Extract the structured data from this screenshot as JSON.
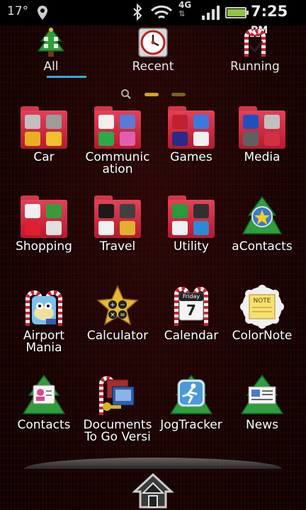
{
  "status_bar": {
    "temperature": "17°",
    "network": "4G",
    "time": "7:25",
    "ampm": "PM",
    "battery_level": 0.95
  },
  "tabs": [
    {
      "label": "All",
      "active": true,
      "icon": "all-apps-tree-icon"
    },
    {
      "label": "Recent",
      "active": false,
      "icon": "recent-clock-icon"
    },
    {
      "label": "Running",
      "active": false,
      "icon": "running-candy-cane-icon"
    }
  ],
  "pages": {
    "current": 1,
    "total": 2
  },
  "apps": [
    {
      "label": "Car",
      "type": "folder",
      "icon": "car-folder-icon"
    },
    {
      "label": "Communic\nation",
      "type": "folder",
      "icon": "communication-folder-icon"
    },
    {
      "label": "Games",
      "type": "folder",
      "icon": "games-folder-icon"
    },
    {
      "label": "Media",
      "type": "folder",
      "icon": "media-folder-icon"
    },
    {
      "label": "Shopping",
      "type": "folder",
      "icon": "shopping-folder-icon"
    },
    {
      "label": "Travel",
      "type": "folder",
      "icon": "travel-folder-icon"
    },
    {
      "label": "Utility",
      "type": "folder",
      "icon": "utility-folder-icon"
    },
    {
      "label": "aContacts",
      "type": "app",
      "icon": "acontacts-icon"
    },
    {
      "label": "Airport\nMania",
      "type": "app",
      "icon": "airport-mania-icon"
    },
    {
      "label": "Calculator",
      "type": "app",
      "icon": "calculator-icon"
    },
    {
      "label": "Calendar",
      "type": "app",
      "icon": "calendar-icon",
      "badge_day": "Friday",
      "badge_date": "7"
    },
    {
      "label": "ColorNote",
      "type": "app",
      "icon": "colornote-icon",
      "badge_text": "NOTE"
    },
    {
      "label": "Contacts",
      "type": "app",
      "icon": "contacts-icon"
    },
    {
      "label": "Documents\nTo Go Versi",
      "type": "app",
      "icon": "documents-to-go-icon"
    },
    {
      "label": "JogTracker",
      "type": "app",
      "icon": "jogtracker-icon"
    },
    {
      "label": "News",
      "type": "app",
      "icon": "news-icon"
    }
  ],
  "colors": {
    "folder_red": "#d4364a",
    "active_tab_underline": "#3aa8d8",
    "page_dot_active": "#d6a514"
  }
}
